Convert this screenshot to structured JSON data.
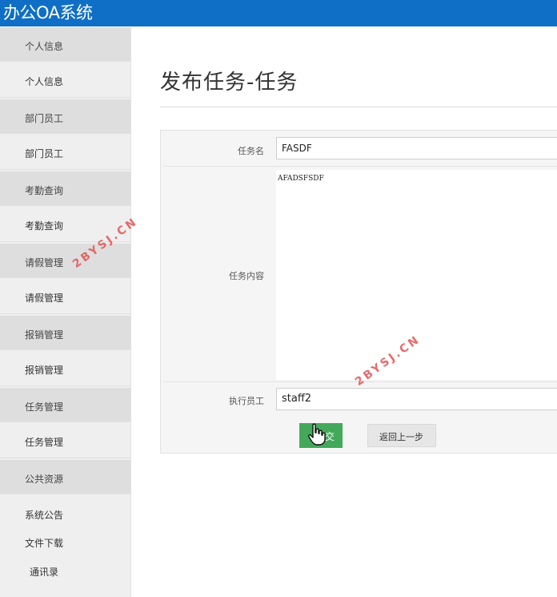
{
  "app": {
    "title": "办公OA系统"
  },
  "sidebar": {
    "items": [
      {
        "label": "个人信息",
        "kind": "category"
      },
      {
        "label": "个人信息",
        "kind": "link"
      },
      {
        "label": "部门员工",
        "kind": "category"
      },
      {
        "label": "部门员工",
        "kind": "link"
      },
      {
        "label": "考勤查询",
        "kind": "category"
      },
      {
        "label": "考勤查询",
        "kind": "link"
      },
      {
        "label": "请假管理",
        "kind": "category"
      },
      {
        "label": "请假管理",
        "kind": "link"
      },
      {
        "label": "报销管理",
        "kind": "category"
      },
      {
        "label": "报销管理",
        "kind": "link"
      },
      {
        "label": "任务管理",
        "kind": "category"
      },
      {
        "label": "任务管理",
        "kind": "link"
      },
      {
        "label": "公共资源",
        "kind": "category"
      },
      {
        "label": "系统公告",
        "kind": "link"
      },
      {
        "label": "文件下载",
        "kind": "link"
      },
      {
        "label": "通讯录",
        "kind": "link"
      }
    ]
  },
  "main": {
    "page_title": "发布任务-任务",
    "form": {
      "task_name": {
        "label": "任务名",
        "value": "FASDF"
      },
      "task_content": {
        "label": "任务内容",
        "value": "AFADSFSDF"
      },
      "assignee": {
        "label": "执行员工",
        "value": "staff2"
      }
    },
    "submit_label": "提交",
    "submit_visible_text": "交",
    "back_label": "返回上一步"
  },
  "watermark": {
    "text": "2BYSJ.CN",
    "color": "#e45b5b"
  },
  "colors": {
    "header": "#0f6fc6",
    "submit": "#44a85b"
  }
}
